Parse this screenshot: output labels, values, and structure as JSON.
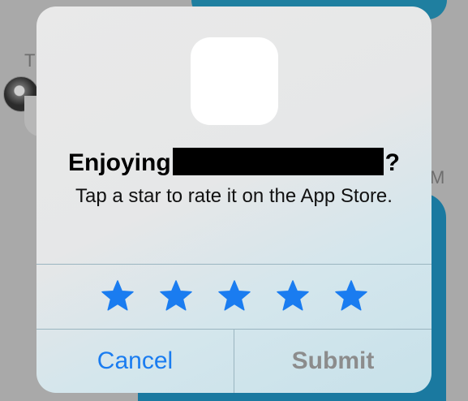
{
  "background": {
    "partial_letter_left": "T",
    "partial_letter_right": "M"
  },
  "alert": {
    "title_prefix": "Enjoying",
    "title_suffix": "?",
    "message": "Tap a star to rate it on the App Store.",
    "rating": {
      "max": 5,
      "selected": 5,
      "star_color": "#1a7cf0"
    },
    "cancel_label": "Cancel",
    "submit_label": "Submit"
  },
  "colors": {
    "accent": "#1a7cf0",
    "disabled_text": "#8c8c8c",
    "chat_bubble": "#1a79a0"
  }
}
